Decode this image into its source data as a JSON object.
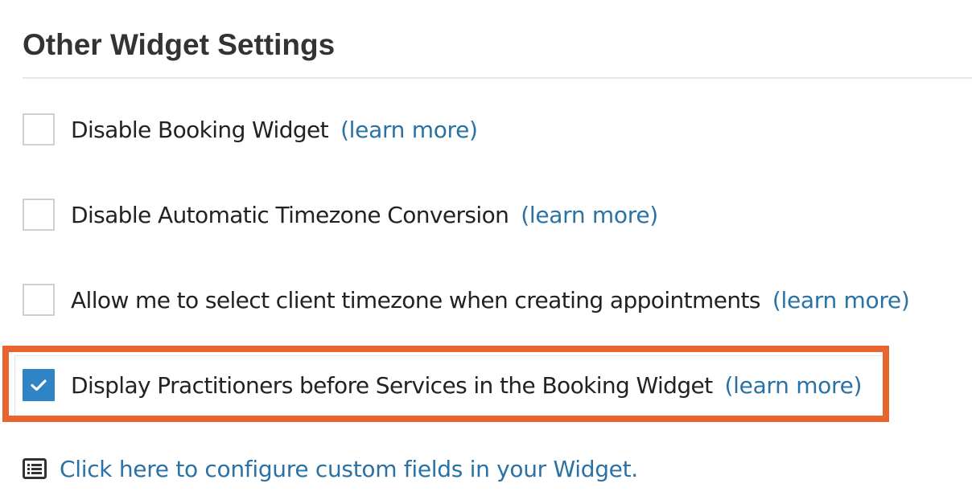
{
  "section": {
    "title": "Other Widget Settings"
  },
  "settings": [
    {
      "label": "Disable Booking Widget",
      "link_text": "(learn more)",
      "checked": false
    },
    {
      "label": "Disable Automatic Timezone Conversion",
      "link_text": "(learn more)",
      "checked": false
    },
    {
      "label": "Allow me to select client timezone when creating appointments",
      "link_text": "(learn more)",
      "checked": false
    },
    {
      "label": "Display Practitioners before Services in the Booking Widget",
      "link_text": "(learn more)",
      "checked": true
    }
  ],
  "custom_fields": {
    "icon": "list-icon",
    "link_text": "Click here to configure custom fields in your Widget."
  },
  "colors": {
    "link": "#2a72a5",
    "checkbox_checked": "#2f84c6",
    "highlight_border": "#e8662e"
  }
}
